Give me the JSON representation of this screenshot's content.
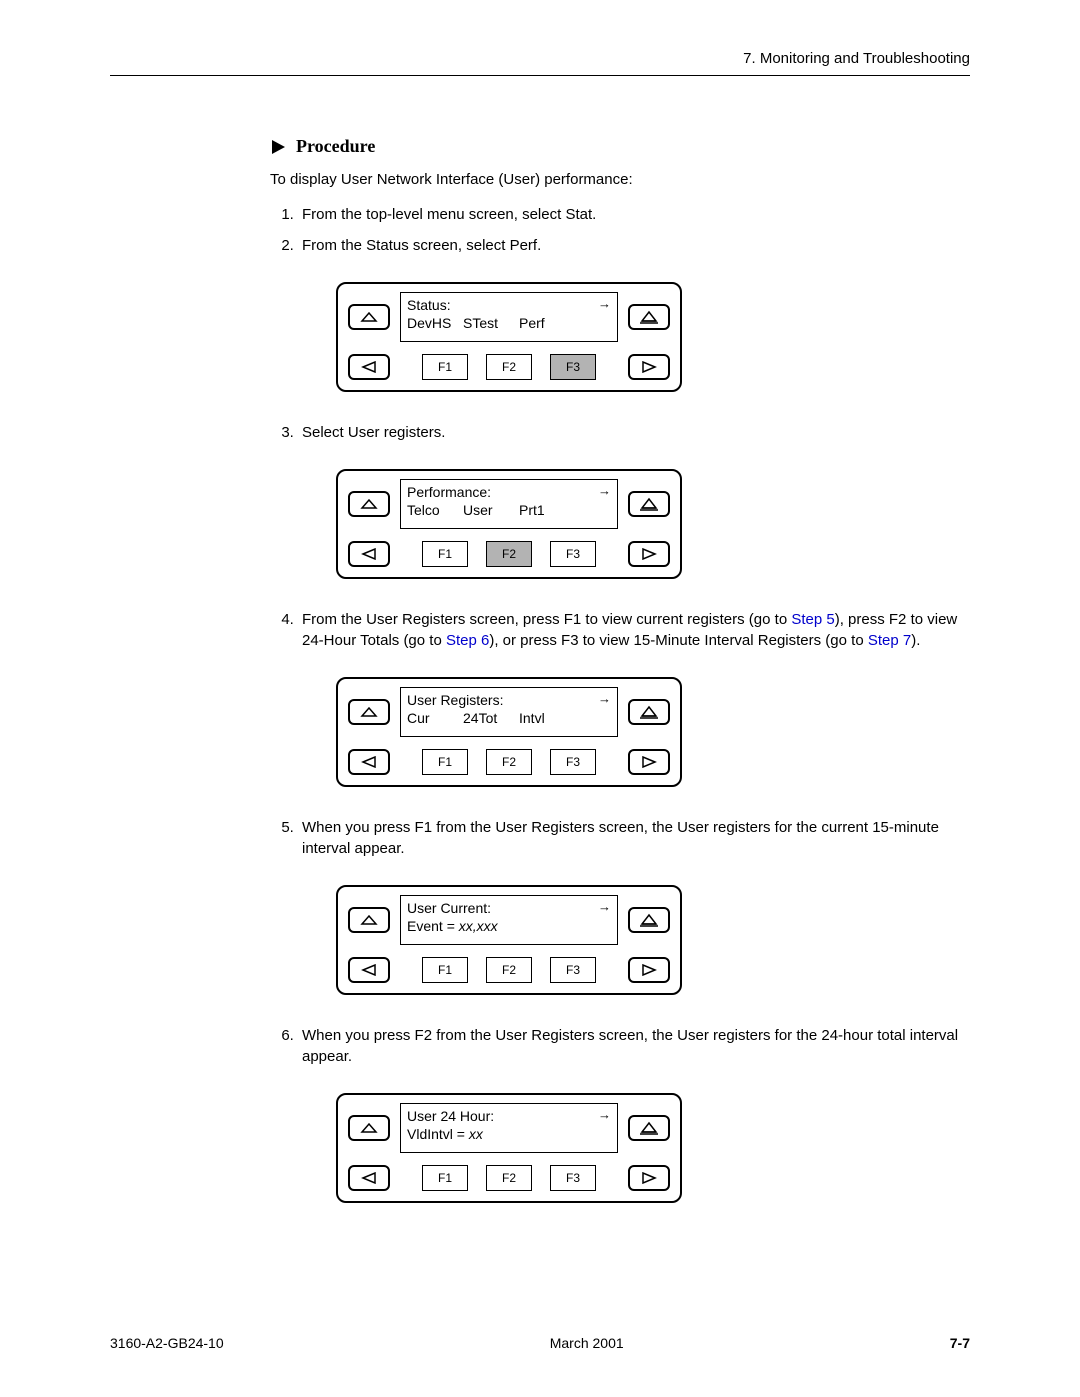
{
  "header": {
    "chapter": "7. Monitoring and Troubleshooting"
  },
  "procedure": {
    "heading": "Procedure",
    "intro": "To display User Network Interface (User) performance:",
    "steps": {
      "s1": "From the top-level menu screen, select Stat.",
      "s2": "From the Status screen, select Perf.",
      "s3": "Select User registers.",
      "s4a": "From the User Registers screen, press F1 to view current registers (go to ",
      "s4_link1": "Step 5",
      "s4b": "), press F2 to view 24-Hour Totals (go to ",
      "s4_link2": "Step 6",
      "s4c": "), or press F3 to view 15-Minute Interval Registers (go to ",
      "s4_link3": "Step 7",
      "s4d": ").",
      "s5": "When you press F1 from the User Registers screen, the User registers for the current 15-minute interval appear.",
      "s6": "When you press F2 from the User Registers screen, the User registers for the 24-hour total interval appear."
    }
  },
  "panels": {
    "fkeys": {
      "f1": "F1",
      "f2": "F2",
      "f3": "F3"
    },
    "p1": {
      "title": "Status:",
      "opt1": "DevHS",
      "opt2": "STest",
      "opt3": "Perf",
      "selected": 3
    },
    "p2": {
      "title": "Performance:",
      "opt1": "Telco",
      "opt2": "User",
      "opt3": "Prt1",
      "selected": 2
    },
    "p3": {
      "title": "User Registers:",
      "opt1": "Cur",
      "opt2": "24Tot",
      "opt3": "Intvl",
      "selected": 0
    },
    "p4": {
      "title": "User Current:",
      "line2a": "Event = ",
      "line2b": "xx,xxx",
      "selected": 0
    },
    "p5": {
      "title": "User 24 Hour:",
      "line2a": "VldIntvl = ",
      "line2b": "xx",
      "selected": 0
    }
  },
  "footer": {
    "docid": "3160-A2-GB24-10",
    "date": "March 2001",
    "page": "7-7"
  }
}
